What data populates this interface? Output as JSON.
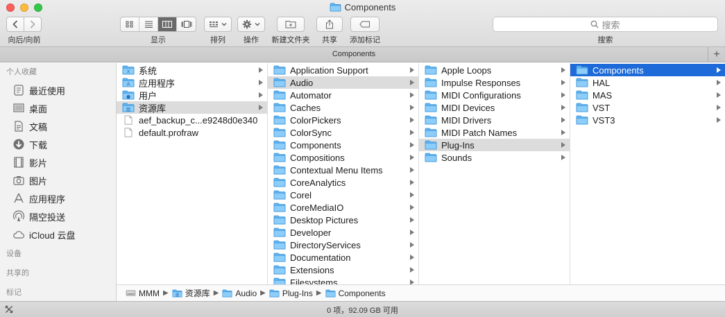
{
  "window": {
    "title": "Components",
    "accent": "#1e6ad8"
  },
  "toolbar": {
    "nav_label": "向后/向前",
    "view_label": "显示",
    "arrange_label": "排列",
    "action_label": "操作",
    "new_folder_label": "新建文件夹",
    "share_label": "共享",
    "tag_label": "添加标记",
    "search_placeholder": "搜索",
    "search_label": "搜索"
  },
  "tabbar": {
    "title": "Components"
  },
  "sidebar": {
    "favorites_title": "个人收藏",
    "items": [
      {
        "label": "最近使用",
        "icon": "recents-icon"
      },
      {
        "label": "桌面",
        "icon": "desktop-icon"
      },
      {
        "label": "文稿",
        "icon": "documents-icon"
      },
      {
        "label": "下载",
        "icon": "downloads-icon"
      },
      {
        "label": "影片",
        "icon": "movies-icon"
      },
      {
        "label": "图片",
        "icon": "pictures-icon"
      },
      {
        "label": "应用程序",
        "icon": "applications-icon"
      },
      {
        "label": "隔空投送",
        "icon": "airdrop-icon"
      },
      {
        "label": "iCloud 云盘",
        "icon": "icloud-icon"
      }
    ],
    "devices_title": "设备",
    "shared_title": "共享的",
    "tags_title": "标记"
  },
  "columns": [
    {
      "items": [
        {
          "name": "系统",
          "type": "system-folder",
          "arrow": true,
          "state": ""
        },
        {
          "name": "应用程序",
          "type": "apps-folder",
          "arrow": true,
          "state": ""
        },
        {
          "name": "用户",
          "type": "users-folder",
          "arrow": true,
          "state": ""
        },
        {
          "name": "资源库",
          "type": "library-folder",
          "arrow": true,
          "state": "gray"
        },
        {
          "name": "aef_backup_c...e9248d0e340",
          "type": "file",
          "arrow": false,
          "state": ""
        },
        {
          "name": "default.profraw",
          "type": "file",
          "arrow": false,
          "state": ""
        }
      ]
    },
    {
      "items": [
        {
          "name": "Application Support",
          "type": "folder",
          "arrow": true,
          "state": ""
        },
        {
          "name": "Audio",
          "type": "folder",
          "arrow": true,
          "state": "gray"
        },
        {
          "name": "Automator",
          "type": "folder",
          "arrow": true,
          "state": ""
        },
        {
          "name": "Caches",
          "type": "folder",
          "arrow": true,
          "state": ""
        },
        {
          "name": "ColorPickers",
          "type": "folder",
          "arrow": true,
          "state": ""
        },
        {
          "name": "ColorSync",
          "type": "folder",
          "arrow": true,
          "state": ""
        },
        {
          "name": "Components",
          "type": "folder",
          "arrow": true,
          "state": ""
        },
        {
          "name": "Compositions",
          "type": "folder",
          "arrow": true,
          "state": ""
        },
        {
          "name": "Contextual Menu Items",
          "type": "folder",
          "arrow": true,
          "state": ""
        },
        {
          "name": "CoreAnalytics",
          "type": "folder",
          "arrow": true,
          "state": ""
        },
        {
          "name": "Corel",
          "type": "folder",
          "arrow": true,
          "state": ""
        },
        {
          "name": "CoreMediaIO",
          "type": "folder",
          "arrow": true,
          "state": ""
        },
        {
          "name": "Desktop Pictures",
          "type": "folder",
          "arrow": true,
          "state": ""
        },
        {
          "name": "Developer",
          "type": "folder",
          "arrow": true,
          "state": ""
        },
        {
          "name": "DirectoryServices",
          "type": "folder",
          "arrow": true,
          "state": ""
        },
        {
          "name": "Documentation",
          "type": "folder",
          "arrow": true,
          "state": ""
        },
        {
          "name": "Extensions",
          "type": "folder",
          "arrow": true,
          "state": ""
        },
        {
          "name": "Filesystems",
          "type": "folder",
          "arrow": true,
          "state": ""
        }
      ]
    },
    {
      "items": [
        {
          "name": "Apple Loops",
          "type": "folder",
          "arrow": true,
          "state": ""
        },
        {
          "name": "Impulse Responses",
          "type": "folder",
          "arrow": true,
          "state": ""
        },
        {
          "name": "MIDI Configurations",
          "type": "folder",
          "arrow": true,
          "state": ""
        },
        {
          "name": "MIDI Devices",
          "type": "folder",
          "arrow": true,
          "state": ""
        },
        {
          "name": "MIDI Drivers",
          "type": "folder",
          "arrow": true,
          "state": ""
        },
        {
          "name": "MIDI Patch Names",
          "type": "folder",
          "arrow": true,
          "state": ""
        },
        {
          "name": "Plug-Ins",
          "type": "folder",
          "arrow": true,
          "state": "gray"
        },
        {
          "name": "Sounds",
          "type": "folder",
          "arrow": true,
          "state": ""
        }
      ]
    },
    {
      "items": [
        {
          "name": "Components",
          "type": "folder",
          "arrow": true,
          "state": "blue"
        },
        {
          "name": "HAL",
          "type": "folder",
          "arrow": true,
          "state": ""
        },
        {
          "name": "MAS",
          "type": "folder",
          "arrow": true,
          "state": ""
        },
        {
          "name": "VST",
          "type": "folder",
          "arrow": true,
          "state": ""
        },
        {
          "name": "VST3",
          "type": "folder",
          "arrow": true,
          "state": ""
        }
      ]
    }
  ],
  "pathbar": [
    {
      "label": "MMM",
      "icon": "disk-icon"
    },
    {
      "label": "资源库",
      "icon": "library-folder-icon"
    },
    {
      "label": "Audio",
      "icon": "folder-icon"
    },
    {
      "label": "Plug-Ins",
      "icon": "folder-icon"
    },
    {
      "label": "Components",
      "icon": "folder-icon"
    }
  ],
  "status": {
    "text": "0 项，92.09 GB 可用"
  }
}
